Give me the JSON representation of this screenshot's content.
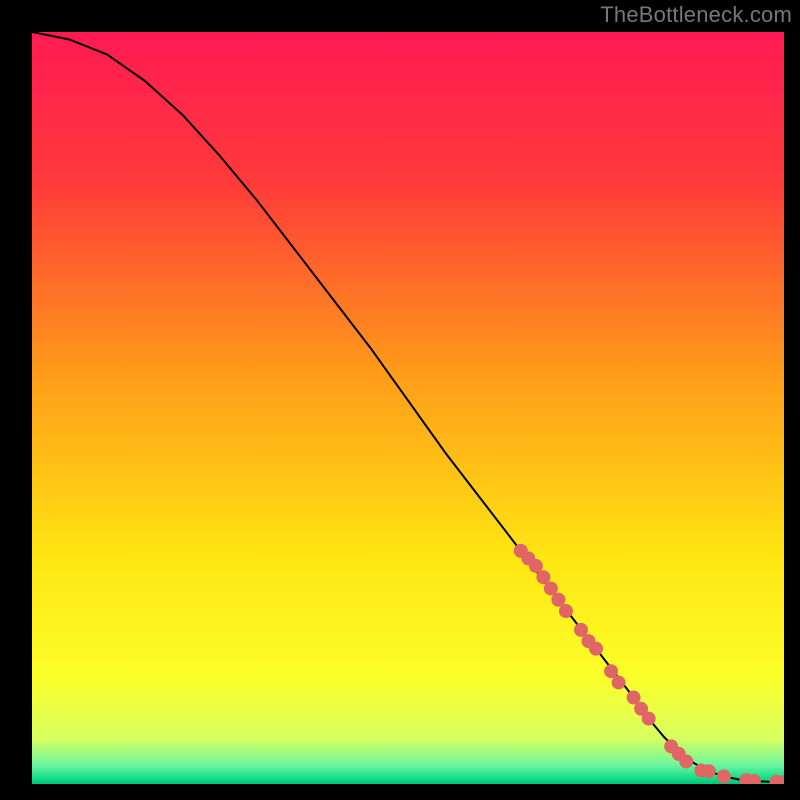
{
  "watermark": "TheBottleneck.com",
  "chart_data": {
    "type": "line",
    "title": "",
    "xlabel": "",
    "ylabel": "",
    "xlim": [
      0,
      100
    ],
    "ylim": [
      0,
      100
    ],
    "gradient_stops": [
      {
        "offset": 0.0,
        "color": "#ff1a53"
      },
      {
        "offset": 0.2,
        "color": "#ff3a3a"
      },
      {
        "offset": 0.45,
        "color": "#ff9a1a"
      },
      {
        "offset": 0.7,
        "color": "#ffe612"
      },
      {
        "offset": 0.86,
        "color": "#fbff2a"
      },
      {
        "offset": 0.94,
        "color": "#d7ff60"
      },
      {
        "offset": 0.975,
        "color": "#6cf59f"
      },
      {
        "offset": 0.99,
        "color": "#1fe08a"
      },
      {
        "offset": 1.0,
        "color": "#00c477"
      }
    ],
    "series": [
      {
        "name": "curve",
        "x": [
          0,
          5,
          10,
          15,
          20,
          25,
          30,
          35,
          40,
          45,
          50,
          55,
          60,
          65,
          70,
          75,
          80,
          82,
          84,
          86,
          88,
          90,
          92,
          94,
          96,
          98,
          100
        ],
        "y": [
          100,
          99,
          97,
          93.5,
          89,
          83.5,
          77.5,
          71,
          64.5,
          58,
          51,
          44,
          37.5,
          31,
          24.5,
          18,
          11.5,
          8.7,
          6.3,
          4.3,
          2.8,
          1.7,
          1.0,
          0.6,
          0.4,
          0.3,
          0.25
        ]
      }
    ],
    "markers": {
      "name": "highlight-points",
      "color": "#e06666",
      "radius_px": 7,
      "x": [
        65,
        66,
        67,
        68,
        69,
        70,
        71,
        73,
        74,
        75,
        77,
        78,
        80,
        81,
        82,
        85,
        86,
        87,
        89,
        90,
        92,
        95,
        96,
        99,
        100
      ],
      "y": [
        31,
        30,
        29,
        27.5,
        26,
        24.5,
        23,
        20.5,
        19,
        18,
        15,
        13.5,
        11.5,
        10,
        8.7,
        5,
        4,
        3,
        1.8,
        1.7,
        1.0,
        0.5,
        0.4,
        0.28,
        0.25
      ]
    }
  }
}
